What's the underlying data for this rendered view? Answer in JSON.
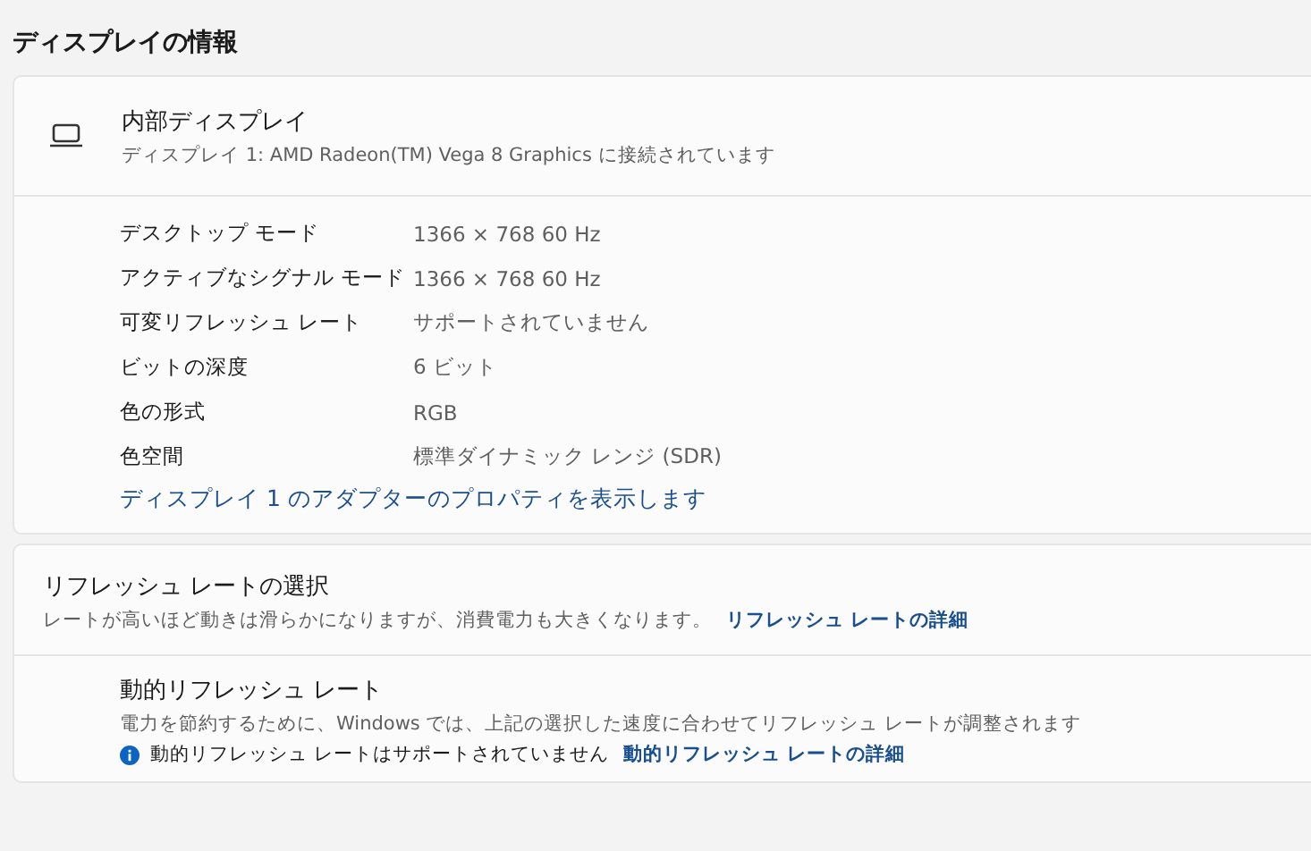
{
  "heading": "ディスプレイの情報",
  "display": {
    "title": "内部ディスプレイ",
    "subtitle": "ディスプレイ 1: AMD Radeon(TM) Vega 8 Graphics に接続されています",
    "properties": [
      {
        "label": "デスクトップ モード",
        "value": "1366 × 768 60 Hz"
      },
      {
        "label": "アクティブなシグナル モード",
        "value": "1366 × 768 60 Hz"
      },
      {
        "label": "可変リフレッシュ レート",
        "value": "サポートされていません"
      },
      {
        "label": "ビットの深度",
        "value": "6 ビット"
      },
      {
        "label": "色の形式",
        "value": "RGB"
      },
      {
        "label": "色空間",
        "value": "標準ダイナミック レンジ (SDR)"
      }
    ],
    "link": "ディスプレイ 1 のアダプターのプロパティを表示します"
  },
  "refresh": {
    "title": "リフレッシュ レートの選択",
    "description": "レートが高いほど動きは滑らかになりますが、消費電力も大きくなります。",
    "link": "リフレッシュ レートの詳細"
  },
  "dynamic": {
    "title": "動的リフレッシュ レート",
    "description": "電力を節約するために、Windows では、上記の選択した速度に合わせてリフレッシュ レートが調整されます",
    "notice": "動的リフレッシュ レートはサポートされていません",
    "link": "動的リフレッシュ レートの詳細"
  }
}
